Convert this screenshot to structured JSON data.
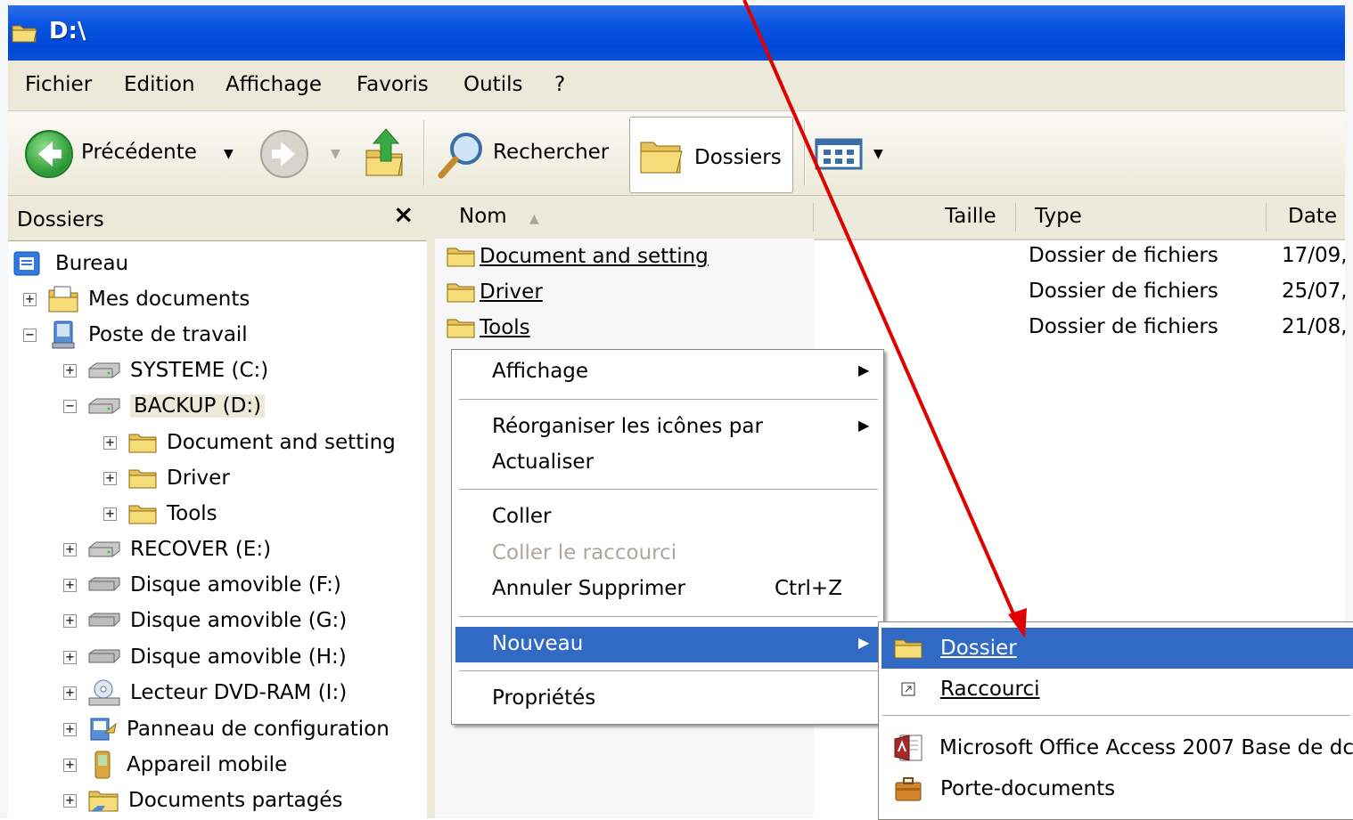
{
  "window": {
    "title": "D:\\"
  },
  "menubar": [
    "Fichier",
    "Edition",
    "Affichage",
    "Favoris",
    "Outils",
    "?"
  ],
  "toolbar": {
    "back_label": "Précédente",
    "search_label": "Rechercher",
    "folders_label": "Dossiers"
  },
  "left_pane": {
    "title": "Dossiers",
    "close": "×",
    "tree": [
      {
        "label": "Bureau",
        "icon": "desktop-icon",
        "expander": ""
      },
      {
        "label": "Mes documents",
        "icon": "my-documents-icon",
        "expander": "+"
      },
      {
        "label": "Poste de travail",
        "icon": "my-computer-icon",
        "expander": "−"
      },
      {
        "label": "SYSTEME (C:)",
        "icon": "hard-drive-icon",
        "expander": "+"
      },
      {
        "label": "BACKUP (D:)",
        "icon": "hard-drive-icon",
        "expander": "−"
      },
      {
        "label": "Document and setting",
        "icon": "folder-icon",
        "expander": "+"
      },
      {
        "label": "Driver",
        "icon": "folder-icon",
        "expander": "+"
      },
      {
        "label": "Tools",
        "icon": "folder-icon",
        "expander": "+"
      },
      {
        "label": "RECOVER (E:)",
        "icon": "hard-drive-icon",
        "expander": "+"
      },
      {
        "label": "Disque amovible (F:)",
        "icon": "removable-drive-icon",
        "expander": "+"
      },
      {
        "label": "Disque amovible (G:)",
        "icon": "removable-drive-icon",
        "expander": "+"
      },
      {
        "label": "Disque amovible (H:)",
        "icon": "removable-drive-icon",
        "expander": "+"
      },
      {
        "label": "Lecteur DVD-RAM (I:)",
        "icon": "dvd-drive-icon",
        "expander": "+"
      },
      {
        "label": "Panneau de configuration",
        "icon": "control-panel-icon",
        "expander": "+"
      },
      {
        "label": "Appareil mobile",
        "icon": "mobile-device-icon",
        "expander": "+"
      },
      {
        "label": "Documents partagés",
        "icon": "shared-folder-icon",
        "expander": "+"
      }
    ]
  },
  "columns": {
    "name": "Nom",
    "size": "Taille",
    "type": "Type",
    "date": "Date"
  },
  "files": [
    {
      "name": "Document and setting",
      "type": "Dossier de fichiers",
      "date": "17/09,"
    },
    {
      "name": "Driver",
      "type": "Dossier de fichiers",
      "date": "25/07,"
    },
    {
      "name": "Tools",
      "type": "Dossier de fichiers",
      "date": "21/08,"
    }
  ],
  "context_menu": {
    "view": "Affichage",
    "arrange": "Réorganiser les icônes par",
    "refresh": "Actualiser",
    "paste": "Coller",
    "paste_shortcut": "Coller le raccourci",
    "undo": "Annuler Supprimer",
    "undo_shortcut": "Ctrl+Z",
    "new": "Nouveau",
    "properties": "Propriétés"
  },
  "submenu": {
    "folder": "Dossier",
    "shortcut": "Raccourci",
    "access": "Microsoft Office Access 2007 Base de dc",
    "briefcase": "Porte-documents"
  },
  "colors": {
    "titlebar": "#0a55e2",
    "highlight": "#316ac5",
    "annotation_arrow": "#e00000"
  }
}
